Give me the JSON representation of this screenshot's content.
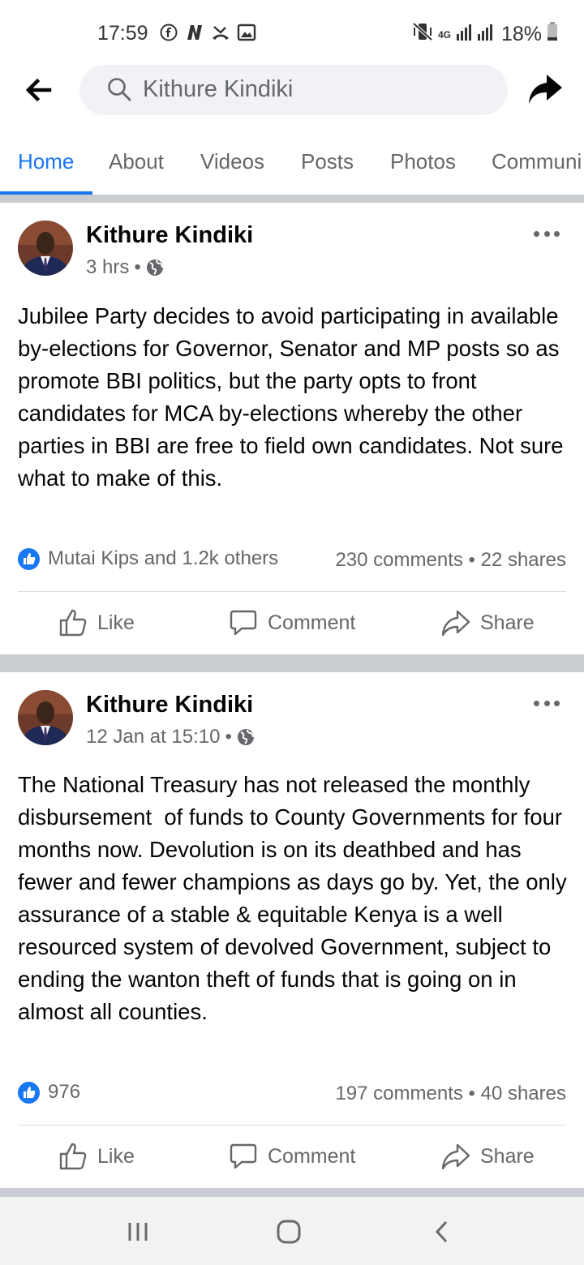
{
  "status_bar": {
    "time": "17:59",
    "network": "4G",
    "battery": "18%"
  },
  "search": {
    "query": "Kithure Kindiki"
  },
  "tabs": [
    {
      "label": "Home",
      "active": true
    },
    {
      "label": "About",
      "active": false
    },
    {
      "label": "Videos",
      "active": false
    },
    {
      "label": "Posts",
      "active": false
    },
    {
      "label": "Photos",
      "active": false
    },
    {
      "label": "Communi",
      "active": false
    }
  ],
  "posts": [
    {
      "author": "Kithure Kindiki",
      "time": "3 hrs",
      "audience_icon": "globe-icon",
      "text": "Jubilee Party decides to avoid participating in available by-elections for Governor, Senator and MP posts so as promote BBI politics, but the party opts to front candidates for MCA by-elections whereby the other parties in BBI are free to field own candidates. Not sure what to make of this.",
      "reactions": "Mutai Kips and 1.2k others",
      "counts": "230 comments • 22 shares"
    },
    {
      "author": "Kithure Kindiki",
      "time": "12 Jan at 15:10",
      "audience_icon": "globe-icon",
      "text": "The National Treasury has not released the monthly disbursement  of funds to County Governments for four months now. Devolution is on its deathbed and has fewer and fewer champions as days go by. Yet, the only assurance of a stable & equitable Kenya is a well resourced system of devolved Government, subject to ending the wanton theft of funds that is going on in almost all counties.",
      "reactions": "976",
      "counts": "197 comments • 40 shares"
    }
  ],
  "actions": {
    "like": "Like",
    "comment": "Comment",
    "share": "Share"
  },
  "colors": {
    "accent": "#1877f2",
    "secondary_text": "#65676b",
    "separator": "#c9ccd1"
  }
}
